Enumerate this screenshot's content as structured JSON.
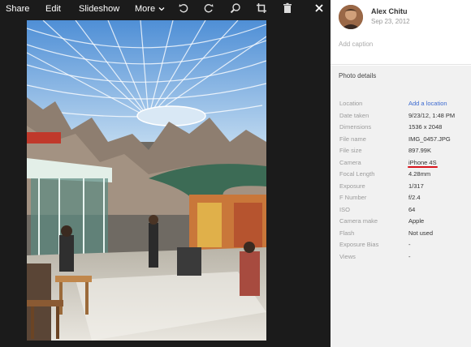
{
  "toolbar": {
    "share": "Share",
    "edit": "Edit",
    "slideshow": "Slideshow",
    "more": "More",
    "icons": [
      "rotate-left-icon",
      "rotate-right-icon",
      "zoom-icon",
      "crop-icon",
      "trash-icon",
      "close-icon"
    ]
  },
  "owner": {
    "name": "Alex Chitu",
    "date": "Sep 23, 2012"
  },
  "caption_placeholder": "Add caption",
  "details": {
    "title": "Photo details",
    "rows": [
      {
        "label": "Location",
        "value": "Add a location"
      },
      {
        "label": "Date taken",
        "value": "9/23/12, 1:48 PM"
      },
      {
        "label": "Dimensions",
        "value": "1536 x 2048"
      },
      {
        "label": "File name",
        "value": "IMG_0457.JPG"
      },
      {
        "label": "File size",
        "value": "897.99K"
      },
      {
        "label": "Camera",
        "value": "iPhone 4S"
      },
      {
        "label": "Focal Length",
        "value": "4.28mm"
      },
      {
        "label": "Exposure",
        "value": "1/317"
      },
      {
        "label": "F Number",
        "value": "f/2.4"
      },
      {
        "label": "ISO",
        "value": "64"
      },
      {
        "label": "Camera make",
        "value": "Apple"
      },
      {
        "label": "Flash",
        "value": "Not used"
      },
      {
        "label": "Exposure Bias",
        "value": "-"
      },
      {
        "label": "Views",
        "value": "-"
      }
    ]
  },
  "colors": {
    "viewer_bg": "#1b1b1b",
    "panel_bg": "#f1f1f1",
    "link": "#3d6bd0",
    "highlight": "#d8141c"
  }
}
